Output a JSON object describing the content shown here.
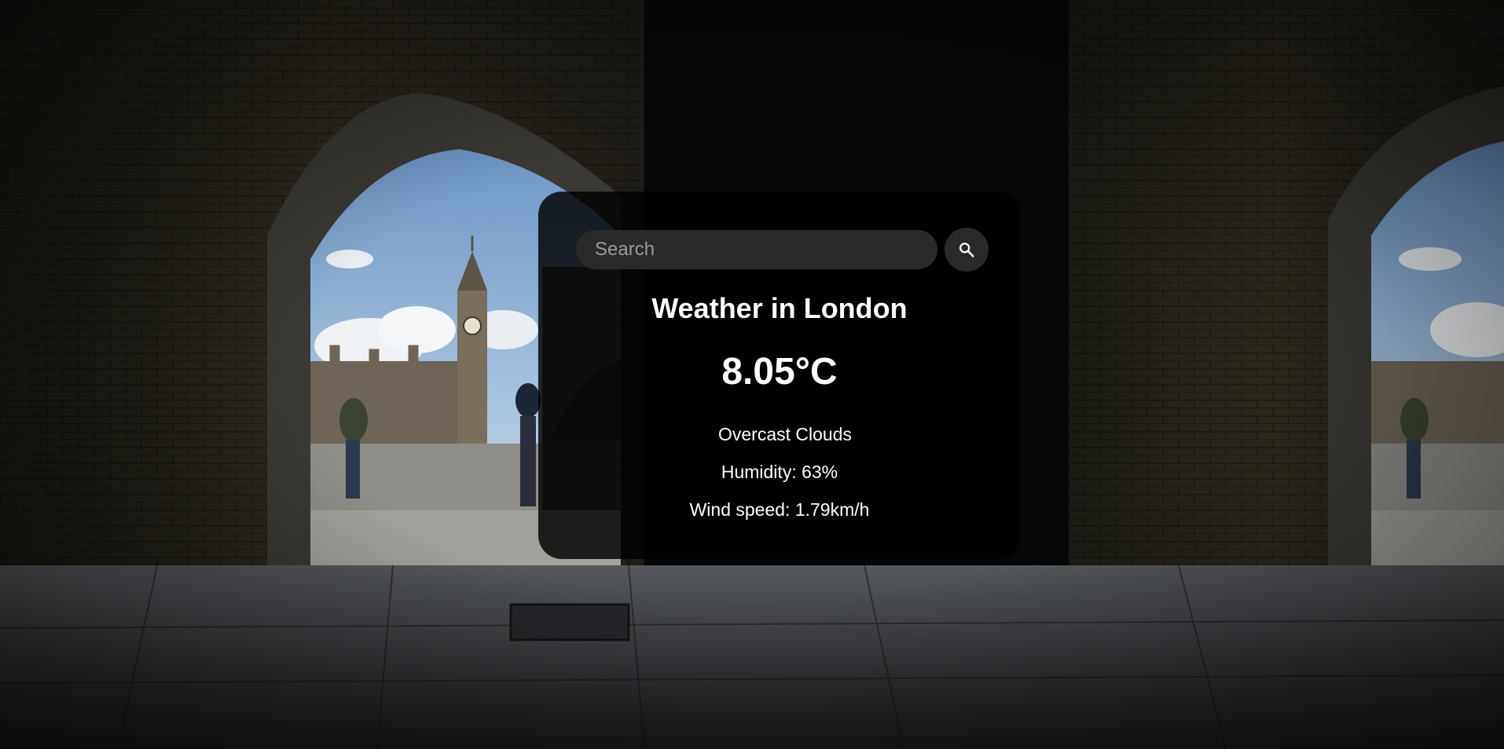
{
  "search": {
    "placeholder": "Search",
    "button_icon": "search-icon"
  },
  "weather": {
    "city_heading": "Weather in London",
    "temperature": "8.05°C",
    "description": "Overcast Clouds",
    "humidity": "Humidity: 63%",
    "wind": "Wind speed: 1.79km/h"
  },
  "background": {
    "subject": "London arched underpass with Big Ben view",
    "colors": {
      "sky": "#8fb1d6",
      "brick": "#2a271c",
      "stone": "#4a4d52",
      "card": "#000000"
    }
  }
}
